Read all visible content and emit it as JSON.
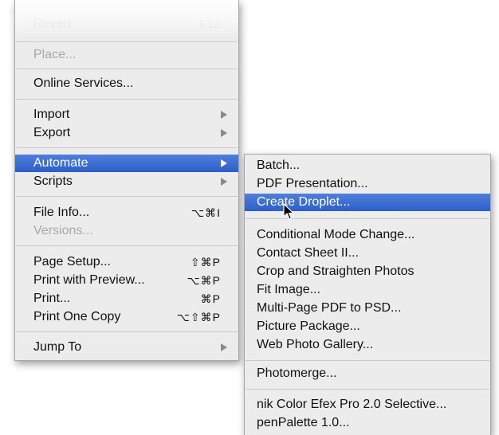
{
  "main_menu": {
    "revert": {
      "label": "Revert",
      "shortcut": "F12"
    },
    "place": {
      "label": "Place..."
    },
    "online_services": {
      "label": "Online Services..."
    },
    "import": {
      "label": "Import"
    },
    "export": {
      "label": "Export"
    },
    "automate": {
      "label": "Automate"
    },
    "scripts": {
      "label": "Scripts"
    },
    "file_info": {
      "label": "File Info...",
      "shortcut": "⌥⌘I"
    },
    "versions": {
      "label": "Versions..."
    },
    "page_setup": {
      "label": "Page Setup...",
      "shortcut": "⇧⌘P"
    },
    "print_with_preview": {
      "label": "Print with Preview...",
      "shortcut": "⌥⌘P"
    },
    "print": {
      "label": "Print...",
      "shortcut": "⌘P"
    },
    "print_one_copy": {
      "label": "Print One Copy",
      "shortcut": "⌥⇧⌘P"
    },
    "jump_to": {
      "label": "Jump To"
    }
  },
  "automate_submenu": {
    "batch": "Batch...",
    "pdf_presentation": "PDF Presentation...",
    "create_droplet": "Create Droplet...",
    "conditional_mode_change": "Conditional Mode Change...",
    "contact_sheet": "Contact Sheet II...",
    "crop_straighten": "Crop and Straighten Photos",
    "fit_image": "Fit Image...",
    "multipage_pdf": "Multi-Page PDF to PSD...",
    "picture_package": "Picture Package...",
    "web_photo_gallery": "Web Photo Gallery...",
    "photomerge": "Photomerge...",
    "nik_color_efex": "nik Color Efex Pro 2.0 Selective...",
    "penpalette": "penPalette 1.0..."
  },
  "highlight_color": "#3a6bd0"
}
